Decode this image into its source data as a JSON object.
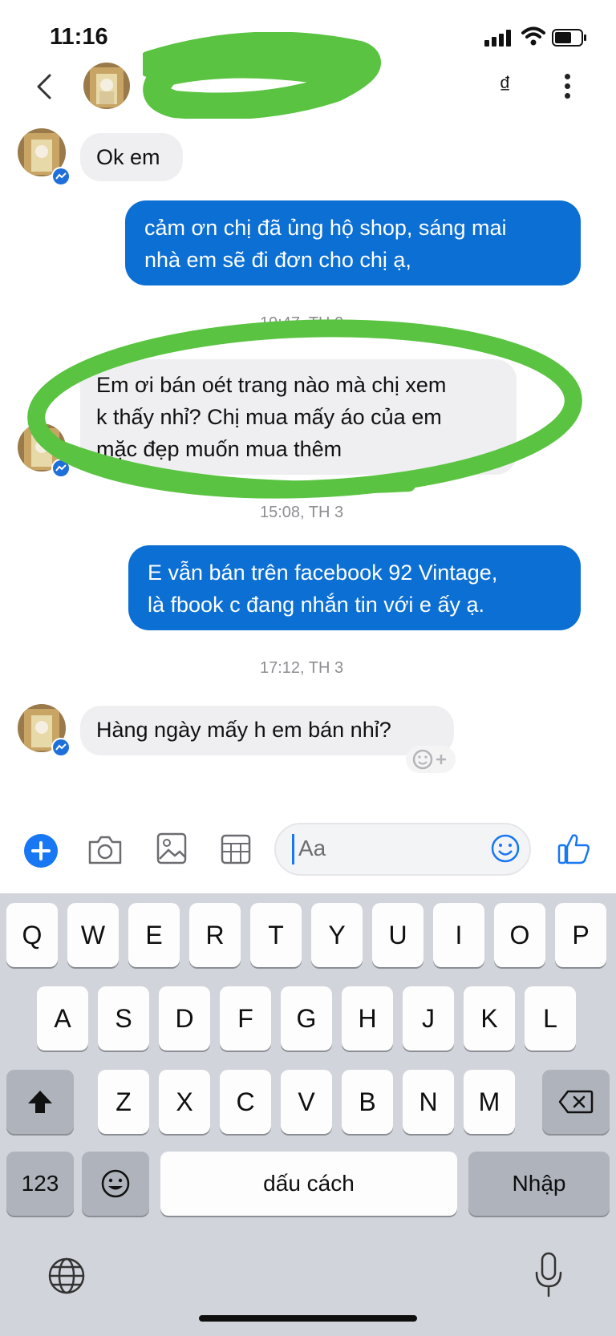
{
  "status_bar": {
    "time": "11:16"
  },
  "header": {
    "currency_icon_glyph": "₫"
  },
  "messages": [
    {
      "id": "m1",
      "side": "in",
      "text": "Ok em"
    },
    {
      "id": "m2",
      "side": "out",
      "lines": [
        "cảm ơn chị đã ủng hộ shop, sáng mai",
        "nhà em sẽ đi đơn cho chị ạ,"
      ]
    },
    {
      "id": "t1",
      "type": "timestamp",
      "text": "19:47, TH 2"
    },
    {
      "id": "m3",
      "side": "in",
      "lines": [
        "Em ơi bán oét trang nào mà chị xem",
        "k thấy nhỉ? Chị mua mấy áo của em",
        "mặc đẹp muốn mua thêm"
      ]
    },
    {
      "id": "t2",
      "type": "timestamp",
      "text": "15:08, TH 3"
    },
    {
      "id": "m4",
      "side": "out",
      "lines": [
        "E vẫn bán trên facebook  92 Vintage,",
        "là fbook c đang nhắn tin với e ấy ạ."
      ]
    },
    {
      "id": "t3",
      "type": "timestamp",
      "text": "17:12, TH 3"
    },
    {
      "id": "m5",
      "side": "in",
      "text": "Hàng ngày mấy h em bán nhỉ?"
    }
  ],
  "composer": {
    "placeholder": "Aa",
    "accent_color": "#1877f2"
  },
  "keyboard": {
    "row1": [
      "Q",
      "W",
      "E",
      "R",
      "T",
      "Y",
      "U",
      "I",
      "O",
      "P"
    ],
    "row2": [
      "A",
      "S",
      "D",
      "F",
      "G",
      "H",
      "J",
      "K",
      "L"
    ],
    "row3": [
      "Z",
      "X",
      "C",
      "V",
      "B",
      "N",
      "M"
    ],
    "numbers_label": "123",
    "space_label": "dấu cách",
    "return_label": "Nhập"
  },
  "colors": {
    "outgoing_bubble": "#0b6fd4",
    "incoming_bubble": "#efeff1",
    "highlight_marker": "#5ac341"
  }
}
